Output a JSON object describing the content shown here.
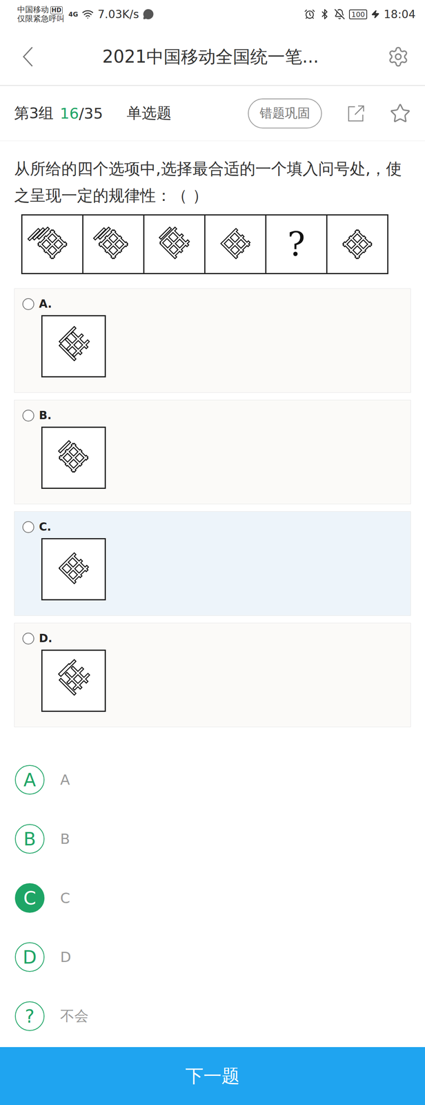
{
  "status_bar": {
    "carrier": "中国移动",
    "carrier_badge": "HD",
    "emergency": "仅限紧急呼叫",
    "network": "4G",
    "speed": "7.03K/s",
    "battery": "100",
    "time": "18:04"
  },
  "header": {
    "title": "2021中国移动全国统一笔..."
  },
  "toolbar": {
    "group": "第3组",
    "current": "16",
    "total": "/35",
    "type": "单选题",
    "review_button": "错题巩固",
    "starred": false
  },
  "question": {
    "text": "从所给的四个选项中,选择最合适的一个填入问号处,，使之呈现一定的规律性：（ ）",
    "panels": [
      {
        "kind": "figure"
      },
      {
        "kind": "figure"
      },
      {
        "kind": "figure"
      },
      {
        "kind": "figure"
      },
      {
        "kind": "blank",
        "text": "?"
      },
      {
        "kind": "figure"
      }
    ]
  },
  "options": [
    {
      "label": "A.",
      "selected": false,
      "hovered": false
    },
    {
      "label": "B.",
      "selected": false,
      "hovered": false
    },
    {
      "label": "C.",
      "selected": false,
      "hovered": true
    },
    {
      "label": "D.",
      "selected": false,
      "hovered": false
    }
  ],
  "answers": [
    {
      "letter": "A",
      "text": "A",
      "selected": false
    },
    {
      "letter": "B",
      "text": "B",
      "selected": false
    },
    {
      "letter": "C",
      "text": "C",
      "selected": true
    },
    {
      "letter": "D",
      "text": "D",
      "selected": false
    },
    {
      "letter": "?",
      "text": "不会",
      "selected": false
    }
  ],
  "next_button": "下一题"
}
